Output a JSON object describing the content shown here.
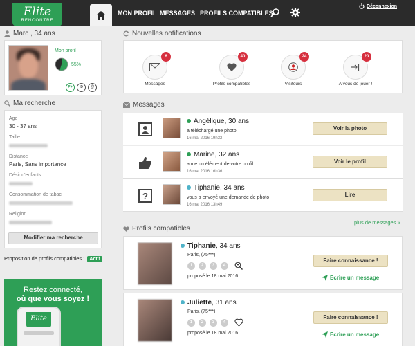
{
  "header": {
    "logo_main": "Elite",
    "logo_sub": "RENCONTRE",
    "nav": [
      "MON PROFIL",
      "MESSAGES",
      "PROFILS COMPATIBLES"
    ],
    "logout": "Déconnexion"
  },
  "user": {
    "title": "Marc , 34 ans",
    "profile_link": "Mon profil",
    "completion": "55%",
    "completion_value": 0.55
  },
  "search": {
    "title": "Ma recherche",
    "age_label": "Age",
    "age_value": "30 - 37 ans",
    "size_label": "Taille",
    "distance_label": "Distance",
    "distance_value": "Paris, Sans importance",
    "children_label": "Désir d'enfants",
    "tobacco_label": "Consommation de tabac",
    "religion_label": "Religion",
    "modify_button": "Modifier ma recherche",
    "proposal_text": "Proposition de profils compatibles :",
    "proposal_status": "Actif"
  },
  "ad": {
    "line1": "Restez connecté,",
    "line2": "où que vous soyez !",
    "phone_logo": "Elite"
  },
  "notifications": {
    "title": "Nouvelles notifications",
    "items": [
      {
        "label": "Messages",
        "count": "6"
      },
      {
        "label": "Profils compatibles",
        "count": "40"
      },
      {
        "label": "Visiteurs",
        "count": "24"
      },
      {
        "label": "A vous de jouer !",
        "count": "20"
      }
    ]
  },
  "messages": {
    "title": "Messages",
    "more_link": "plus de messages »",
    "items": [
      {
        "name": "Angélique, 30 ans",
        "text": "a téléchargé une photo",
        "date": "16 mai 2016  19h32",
        "button": "Voir la photo",
        "status_color": "#2e9f56"
      },
      {
        "name": "Marine, 32 ans",
        "text": "aime un élément de votre profil",
        "date": "16 mai 2016  16h36",
        "button": "Voir le profil",
        "status_color": "#2e9f56"
      },
      {
        "name": "Tiphanie, 34 ans",
        "text": "vous a envoyé une demande de photo",
        "date": "16 mai 2016  13h49",
        "button": "Lire",
        "status_color": "#4fb3c9"
      }
    ]
  },
  "compatible": {
    "title": "Profils compatibles",
    "items": [
      {
        "name": "Tiphanie",
        "age": ", 34 ans",
        "city": "Paris, (75***)",
        "proposed": "proposé le 18 mai 2016",
        "button": "Faire connaissance !",
        "link": "Ecrire un message",
        "status_color": "#4fb3c9",
        "pills": [
          "1",
          "2",
          "3",
          "4"
        ]
      },
      {
        "name": "Juliette",
        "age": ", 31 ans",
        "city": "Paris, (75***)",
        "proposed": "proposé le 18 mai 2016",
        "button": "Faire connaissance !",
        "link": "Ecrire un message",
        "status_color": "#4fb3c9",
        "pills": [
          "1",
          "2",
          "3",
          "4"
        ]
      }
    ]
  },
  "colors": {
    "brand_green": "#2e9f56",
    "badge_red": "#d6303f",
    "online_blue": "#4fb3c9"
  }
}
